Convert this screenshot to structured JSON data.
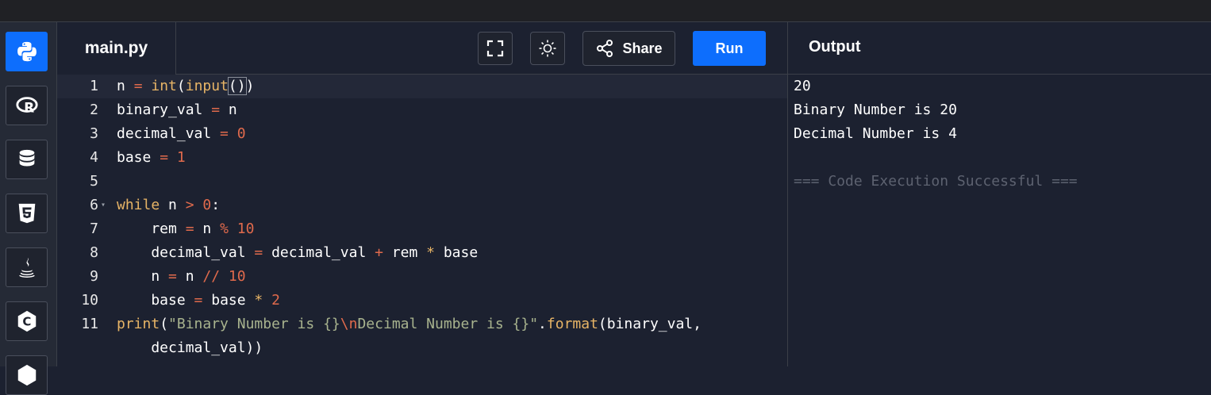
{
  "editor": {
    "filename": "main.py",
    "share_label": "Share",
    "run_label": "Run",
    "icons": [
      "fullscreen-icon",
      "theme-toggle-icon",
      "share-icon"
    ]
  },
  "sidebar": {
    "languages": [
      "python",
      "r",
      "sql",
      "html5",
      "java",
      "c",
      "cpp"
    ],
    "active": "python",
    "accent": "#0d6efd"
  },
  "code": {
    "lines": [
      {
        "num": "1",
        "text": "n = int(input())"
      },
      {
        "num": "2",
        "text": "binary_val = n"
      },
      {
        "num": "3",
        "text": "decimal_val = 0"
      },
      {
        "num": "4",
        "text": "base = 1"
      },
      {
        "num": "5",
        "text": ""
      },
      {
        "num": "6",
        "text": "while n > 0:"
      },
      {
        "num": "7",
        "text": "    rem = n % 10"
      },
      {
        "num": "8",
        "text": "    decimal_val = decimal_val + rem * base"
      },
      {
        "num": "9",
        "text": "    n = n // 10"
      },
      {
        "num": "10",
        "text": "    base = base * 2"
      },
      {
        "num": "11",
        "text": "print(\"Binary Number is {}\\nDecimal Number is {}\".format(binary_val,"
      },
      {
        "num": "",
        "text": "    decimal_val))"
      }
    ]
  },
  "output": {
    "title": "Output",
    "lines": [
      "20",
      "Binary Number is 20",
      "Decimal Number is 4",
      "",
      "=== Code Execution Successful ==="
    ]
  }
}
